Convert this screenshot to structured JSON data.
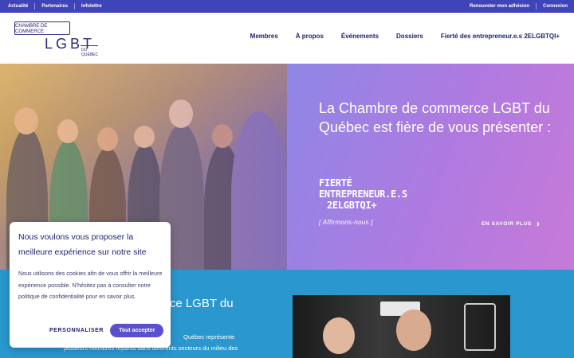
{
  "topbar": {
    "left_links": [
      "Actualité",
      "Partenaires",
      "Infolettre"
    ],
    "right_links": [
      "Renouveler mon adhésion",
      "Connexion"
    ]
  },
  "logo": {
    "box_text": "CHAMBRE DE COMMERCE",
    "main_text": "LGBT",
    "sub_text": "DU QUÉBEC"
  },
  "nav": {
    "items": [
      "Membres",
      "À propos",
      "Événements",
      "Dossiers",
      "Fierté des entrepreneur.e.s 2ELGBTQI+"
    ]
  },
  "hero": {
    "title": "La Chambre de commerce LGBT du Québec est fière de vous présenter :",
    "badge_line1": "FIERTÉ",
    "badge_line2": "ENTREPRENEUR.E.S",
    "badge_line3": "2ELGBTQI+",
    "badge_tagline": "[ Affirmons-nous ]",
    "cta_label": "EN SAVOIR PLUS",
    "colors": {
      "panel_start": "#8f86e6",
      "panel_end": "#c77ad8"
    }
  },
  "lower": {
    "title_visible": "merce LGBT du",
    "text_line1": "Québec représente",
    "text_line2": "plusieurs membres répartis dans différents secteurs du milieu des"
  },
  "cookie": {
    "title": "Nous voulons vous proposer la meilleure expérience sur notre site",
    "body": "Nous utilisons des cookies afin de vous offrir la meilleure expérience possible. N'hésitez pas à consulter notre politique de confidentialité pour en savoir plus.",
    "personalize_label": "PERSONNALISER",
    "accept_label": "Tout accepter"
  },
  "colors": {
    "topbar": "#3f44b8",
    "brand_navy": "#1f2170",
    "lower_bg": "#2a97cf",
    "accept_button": "#5a4fcf"
  }
}
